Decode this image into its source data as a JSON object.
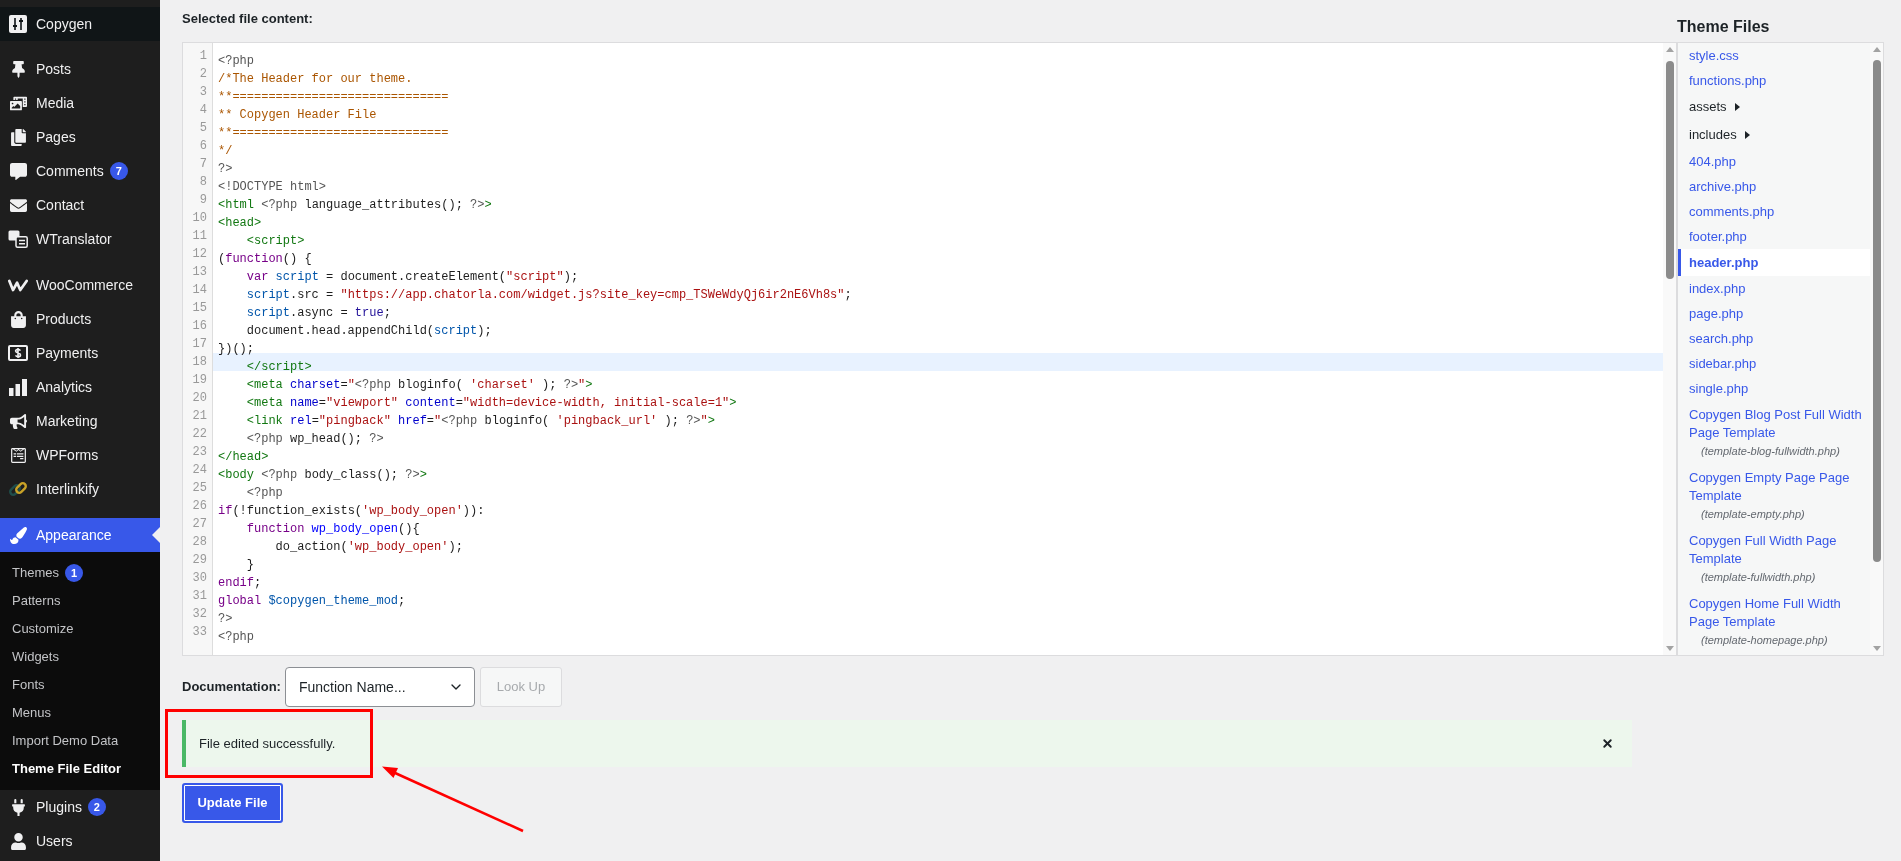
{
  "sidebar": {
    "top_item": {
      "label": "Copygen"
    },
    "groups": [
      {
        "items": [
          {
            "label": "Posts",
            "selected": false
          },
          {
            "label": "Media",
            "selected": false
          },
          {
            "label": "Pages",
            "selected": false
          },
          {
            "label": "Comments",
            "selected": false,
            "badge": "7"
          },
          {
            "label": "Contact",
            "selected": false
          },
          {
            "label": "WTranslator",
            "selected": false
          }
        ]
      },
      {
        "items": [
          {
            "label": "WooCommerce",
            "selected": false
          },
          {
            "label": "Products",
            "selected": false
          },
          {
            "label": "Payments",
            "selected": false
          },
          {
            "label": "Analytics",
            "selected": false
          },
          {
            "label": "Marketing",
            "selected": false
          },
          {
            "label": "WPForms",
            "selected": false
          },
          {
            "label": "Interlinkify",
            "selected": false
          }
        ]
      },
      {
        "items": [
          {
            "label": "Appearance",
            "selected": true,
            "submenu": [
              {
                "label": "Themes",
                "selected": false,
                "badge": "1"
              },
              {
                "label": "Patterns",
                "selected": false
              },
              {
                "label": "Customize",
                "selected": false
              },
              {
                "label": "Widgets",
                "selected": false
              },
              {
                "label": "Fonts",
                "selected": false
              },
              {
                "label": "Menus",
                "selected": false
              },
              {
                "label": "Import Demo Data",
                "selected": false
              },
              {
                "label": "Theme File Editor",
                "selected": true
              }
            ]
          },
          {
            "label": "Plugins",
            "selected": false,
            "badge": "2"
          },
          {
            "label": "Users",
            "selected": false
          }
        ]
      }
    ]
  },
  "editor": {
    "label": "Selected file content:",
    "lines": [
      {
        "number": "1",
        "highlighted": false,
        "tokens": [
          {
            "kind": "meta",
            "text": "<?php"
          }
        ]
      },
      {
        "number": "2",
        "highlighted": false,
        "tokens": [
          {
            "kind": "comment",
            "text": "/*The Header for our theme."
          }
        ]
      },
      {
        "number": "3",
        "highlighted": false,
        "tokens": [
          {
            "kind": "comment",
            "text": "**=============================="
          }
        ]
      },
      {
        "number": "4",
        "highlighted": false,
        "tokens": [
          {
            "kind": "comment",
            "text": "** Copygen Header File"
          }
        ]
      },
      {
        "number": "5",
        "highlighted": false,
        "tokens": [
          {
            "kind": "comment",
            "text": "**=============================="
          }
        ]
      },
      {
        "number": "6",
        "highlighted": false,
        "tokens": [
          {
            "kind": "comment",
            "text": "*/"
          }
        ]
      },
      {
        "number": "7",
        "highlighted": false,
        "tokens": [
          {
            "kind": "meta",
            "text": "?>"
          }
        ]
      },
      {
        "number": "8",
        "highlighted": false,
        "tokens": [
          {
            "kind": "meta",
            "text": "<!DOCTYPE html>"
          }
        ]
      },
      {
        "number": "9",
        "highlighted": false,
        "tokens": [
          {
            "kind": "tag",
            "text": "<html"
          },
          {
            "kind": "meta",
            "text": " <?php"
          },
          {
            "kind": "plain",
            "text": " language_attributes(); "
          },
          {
            "kind": "meta",
            "text": "?>"
          },
          {
            "kind": "tag",
            "text": ">"
          }
        ]
      },
      {
        "number": "10",
        "highlighted": false,
        "tokens": [
          {
            "kind": "tag",
            "text": "<head>"
          }
        ]
      },
      {
        "number": "11",
        "highlighted": false,
        "tokens": [
          {
            "kind": "tag",
            "text": "    <script>"
          }
        ]
      },
      {
        "number": "12",
        "highlighted": false,
        "tokens": [
          {
            "kind": "plain",
            "text": "("
          },
          {
            "kind": "keyword",
            "text": "function"
          },
          {
            "kind": "plain",
            "text": "() {"
          }
        ]
      },
      {
        "number": "13",
        "highlighted": false,
        "tokens": [
          {
            "kind": "keyword",
            "text": "    var"
          },
          {
            "kind": "variable",
            "text": " script"
          },
          {
            "kind": "plain",
            "text": " = document.createElement("
          },
          {
            "kind": "string",
            "text": "\"script\""
          },
          {
            "kind": "plain",
            "text": ");"
          }
        ]
      },
      {
        "number": "14",
        "highlighted": false,
        "tokens": [
          {
            "kind": "variable",
            "text": "    script"
          },
          {
            "kind": "plain",
            "text": ".src = "
          },
          {
            "kind": "string",
            "text": "\"https://app.chatorla.com/widget.js?site_key=cmp_TSWeWdyQj6ir2nE6Vh8s\""
          },
          {
            "kind": "plain",
            "text": ";"
          }
        ]
      },
      {
        "number": "15",
        "highlighted": false,
        "tokens": [
          {
            "kind": "variable",
            "text": "    script"
          },
          {
            "kind": "plain",
            "text": ".async = "
          },
          {
            "kind": "atom",
            "text": "true"
          },
          {
            "kind": "plain",
            "text": ";"
          }
        ]
      },
      {
        "number": "16",
        "highlighted": false,
        "tokens": [
          {
            "kind": "plain",
            "text": "    document.head.appendChild("
          },
          {
            "kind": "variable",
            "text": "script"
          },
          {
            "kind": "plain",
            "text": ");"
          }
        ]
      },
      {
        "number": "17",
        "highlighted": false,
        "tokens": [
          {
            "kind": "plain",
            "text": "})();"
          }
        ]
      },
      {
        "number": "18",
        "highlighted": true,
        "tokens": [
          {
            "kind": "tag",
            "text": "    </script>"
          }
        ]
      },
      {
        "number": "19",
        "highlighted": false,
        "tokens": [
          {
            "kind": "tag",
            "text": "    <meta"
          },
          {
            "kind": "attribute",
            "text": " charset"
          },
          {
            "kind": "plain",
            "text": "="
          },
          {
            "kind": "string",
            "text": "\""
          },
          {
            "kind": "meta",
            "text": "<?php"
          },
          {
            "kind": "plain",
            "text": " bloginfo( "
          },
          {
            "kind": "string",
            "text": "'charset'"
          },
          {
            "kind": "plain",
            "text": " ); "
          },
          {
            "kind": "meta",
            "text": "?>"
          },
          {
            "kind": "string",
            "text": "\""
          },
          {
            "kind": "tag",
            "text": ">"
          }
        ]
      },
      {
        "number": "20",
        "highlighted": false,
        "tokens": [
          {
            "kind": "tag",
            "text": "    <meta"
          },
          {
            "kind": "attribute",
            "text": " name"
          },
          {
            "kind": "plain",
            "text": "="
          },
          {
            "kind": "string",
            "text": "\"viewport\""
          },
          {
            "kind": "attribute",
            "text": " content"
          },
          {
            "kind": "plain",
            "text": "="
          },
          {
            "kind": "string",
            "text": "\"width=device-width, initial-scale=1\""
          },
          {
            "kind": "tag",
            "text": ">"
          }
        ]
      },
      {
        "number": "21",
        "highlighted": false,
        "tokens": [
          {
            "kind": "tag",
            "text": "    <link"
          },
          {
            "kind": "attribute",
            "text": " rel"
          },
          {
            "kind": "plain",
            "text": "="
          },
          {
            "kind": "string",
            "text": "\"pingback\""
          },
          {
            "kind": "attribute",
            "text": " href"
          },
          {
            "kind": "plain",
            "text": "="
          },
          {
            "kind": "string",
            "text": "\""
          },
          {
            "kind": "meta",
            "text": "<?php"
          },
          {
            "kind": "plain",
            "text": " bloginfo( "
          },
          {
            "kind": "string",
            "text": "'pingback_url'"
          },
          {
            "kind": "plain",
            "text": " ); "
          },
          {
            "kind": "meta",
            "text": "?>"
          },
          {
            "kind": "string",
            "text": "\""
          },
          {
            "kind": "tag",
            "text": ">"
          }
        ]
      },
      {
        "number": "22",
        "highlighted": false,
        "tokens": [
          {
            "kind": "meta",
            "text": "    <?php"
          },
          {
            "kind": "plain",
            "text": " wp_head(); "
          },
          {
            "kind": "meta",
            "text": "?>"
          }
        ]
      },
      {
        "number": "23",
        "highlighted": false,
        "tokens": [
          {
            "kind": "tag",
            "text": "</head>"
          }
        ]
      },
      {
        "number": "24",
        "highlighted": false,
        "tokens": [
          {
            "kind": "tag",
            "text": "<body"
          },
          {
            "kind": "meta",
            "text": " <?php"
          },
          {
            "kind": "plain",
            "text": " body_class(); "
          },
          {
            "kind": "meta",
            "text": "?>"
          },
          {
            "kind": "tag",
            "text": ">"
          }
        ]
      },
      {
        "number": "25",
        "highlighted": false,
        "tokens": [
          {
            "kind": "meta",
            "text": "    <?php"
          }
        ]
      },
      {
        "number": "26",
        "highlighted": false,
        "tokens": [
          {
            "kind": "keyword",
            "text": "if"
          },
          {
            "kind": "plain",
            "text": "(!function_exists("
          },
          {
            "kind": "string",
            "text": "'wp_body_open'"
          },
          {
            "kind": "plain",
            "text": ")):"
          }
        ]
      },
      {
        "number": "27",
        "highlighted": false,
        "tokens": [
          {
            "kind": "keyword",
            "text": "    function"
          },
          {
            "kind": "def",
            "text": " wp_body_open"
          },
          {
            "kind": "plain",
            "text": "(){"
          }
        ]
      },
      {
        "number": "28",
        "highlighted": false,
        "tokens": [
          {
            "kind": "plain",
            "text": "        do_action("
          },
          {
            "kind": "string",
            "text": "'wp_body_open'"
          },
          {
            "kind": "plain",
            "text": ");"
          }
        ]
      },
      {
        "number": "29",
        "highlighted": false,
        "tokens": [
          {
            "kind": "plain",
            "text": "    }"
          }
        ]
      },
      {
        "number": "30",
        "highlighted": false,
        "tokens": [
          {
            "kind": "keyword",
            "text": "endif"
          },
          {
            "kind": "plain",
            "text": ";"
          }
        ]
      },
      {
        "number": "31",
        "highlighted": false,
        "tokens": [
          {
            "kind": "keyword",
            "text": "global"
          },
          {
            "kind": "variable",
            "text": " $copygen_theme_mod"
          },
          {
            "kind": "plain",
            "text": ";"
          }
        ]
      },
      {
        "number": "32",
        "highlighted": false,
        "tokens": [
          {
            "kind": "meta",
            "text": "?>"
          }
        ]
      },
      {
        "number": "33",
        "highlighted": false,
        "tokens": [
          {
            "kind": "meta",
            "text": "<?php"
          }
        ]
      }
    ]
  },
  "documentation": {
    "label": "Documentation:",
    "select": {
      "value": "Function Name..."
    },
    "button": {
      "label": "Look Up",
      "disabled": true
    }
  },
  "notice": {
    "message": "File edited successfully.",
    "dismissible": true
  },
  "update_button": {
    "label": "Update File"
  },
  "theme_files": {
    "title": "Theme Files",
    "items": [
      {
        "kind": "file",
        "name": "style.css",
        "selected": false
      },
      {
        "kind": "file",
        "name": "functions.php",
        "selected": false
      },
      {
        "kind": "folder",
        "name": "assets",
        "expanded": false,
        "selected": false
      },
      {
        "kind": "folder",
        "name": "includes",
        "expanded": false,
        "selected": false
      },
      {
        "kind": "file",
        "name": "404.php",
        "selected": false
      },
      {
        "kind": "file",
        "name": "archive.php",
        "selected": false
      },
      {
        "kind": "file",
        "name": "comments.php",
        "selected": false
      },
      {
        "kind": "file",
        "name": "footer.php",
        "selected": false
      },
      {
        "kind": "file",
        "name": "header.php",
        "selected": true
      },
      {
        "kind": "file",
        "name": "index.php",
        "selected": false
      },
      {
        "kind": "file",
        "name": "page.php",
        "selected": false
      },
      {
        "kind": "file",
        "name": "search.php",
        "selected": false
      },
      {
        "kind": "file",
        "name": "sidebar.php",
        "selected": false
      },
      {
        "kind": "file",
        "name": "single.php",
        "selected": false
      },
      {
        "kind": "template",
        "name": "Copygen Blog Post Full Width Page Template",
        "file": "(template-blog-fullwidth.php)",
        "selected": false
      },
      {
        "kind": "template",
        "name": "Copygen Empty Page Page Template",
        "file": "(template-empty.php)",
        "selected": false
      },
      {
        "kind": "template",
        "name": "Copygen Full Width Page Template",
        "file": "(template-fullwidth.php)",
        "selected": false
      },
      {
        "kind": "template",
        "name": "Copygen Home Full Width Page Template",
        "file": "(template-homepage.php)",
        "selected": false
      }
    ]
  },
  "annotations": [
    {
      "kind": "frame"
    },
    {
      "kind": "arrow"
    }
  ]
}
